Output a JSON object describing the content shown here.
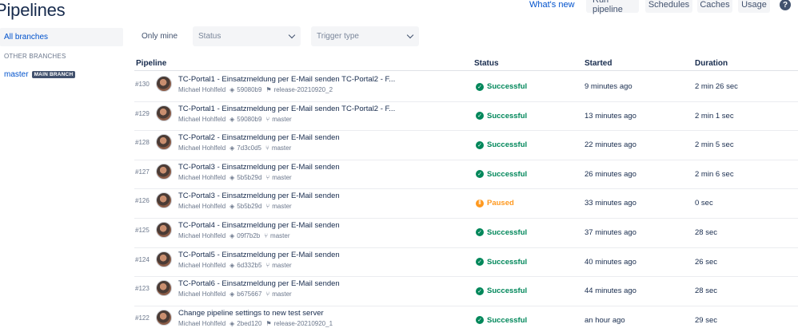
{
  "page": {
    "title": "Pipelines"
  },
  "top_actions": {
    "whats_new": "What's new",
    "run_pipeline": "Run pipeline",
    "schedules": "Schedules",
    "caches": "Caches",
    "usage": "Usage",
    "help_glyph": "?"
  },
  "sidebar": {
    "all_branches": "All branches",
    "other_heading": "OTHER BRANCHES",
    "master_label": "master",
    "main_badge": "MAIN BRANCH"
  },
  "filters": {
    "only_mine": "Only mine",
    "status_placeholder": "Status",
    "trigger_placeholder": "Trigger type"
  },
  "table": {
    "headers": {
      "pipeline": "Pipeline",
      "status": "Status",
      "started": "Started",
      "duration": "Duration"
    },
    "rows": [
      {
        "num": "#130",
        "name": "TC-Portal1 - Einsatzmeldung per E-Mail senden TC-Portal2 - F...",
        "author": "Michael Hohlfeld",
        "commit": "59080b9",
        "ref_icon": "tag-icon",
        "ref": "release-20210920_2",
        "status": "Successful",
        "status_kind": "ok",
        "started": "9 minutes ago",
        "duration": "2 min 26 sec"
      },
      {
        "num": "#129",
        "name": "TC-Portal1 - Einsatzmeldung per E-Mail senden TC-Portal2 - F...",
        "author": "Michael Hohlfeld",
        "commit": "59080b9",
        "ref_icon": "branch-icon",
        "ref": "master",
        "status": "Successful",
        "status_kind": "ok",
        "started": "13 minutes ago",
        "duration": "2 min 1 sec"
      },
      {
        "num": "#128",
        "name": "TC-Portal2 - Einsatzmeldung per E-Mail senden",
        "author": "Michael Hohlfeld",
        "commit": "7d3c0d5",
        "ref_icon": "branch-icon",
        "ref": "master",
        "status": "Successful",
        "status_kind": "ok",
        "started": "22 minutes ago",
        "duration": "2 min 5 sec"
      },
      {
        "num": "#127",
        "name": "TC-Portal3 - Einsatzmeldung per E-Mail senden",
        "author": "Michael Hohlfeld",
        "commit": "5b5b29d",
        "ref_icon": "branch-icon",
        "ref": "master",
        "status": "Successful",
        "status_kind": "ok",
        "started": "26 minutes ago",
        "duration": "2 min 6 sec"
      },
      {
        "num": "#126",
        "name": "TC-Portal3 - Einsatzmeldung per E-Mail senden",
        "author": "Michael Hohlfeld",
        "commit": "5b5b29d",
        "ref_icon": "branch-icon",
        "ref": "master",
        "status": "Paused",
        "status_kind": "paused",
        "started": "33 minutes ago",
        "duration": "0 sec"
      },
      {
        "num": "#125",
        "name": "TC-Portal4 - Einsatzmeldung per E-Mail senden",
        "author": "Michael Hohlfeld",
        "commit": "09f7b2b",
        "ref_icon": "branch-icon",
        "ref": "master",
        "status": "Successful",
        "status_kind": "ok",
        "started": "37 minutes ago",
        "duration": "28 sec"
      },
      {
        "num": "#124",
        "name": "TC-Portal5 - Einsatzmeldung per E-Mail senden",
        "author": "Michael Hohlfeld",
        "commit": "6d332b5",
        "ref_icon": "branch-icon",
        "ref": "master",
        "status": "Successful",
        "status_kind": "ok",
        "started": "40 minutes ago",
        "duration": "26 sec"
      },
      {
        "num": "#123",
        "name": "TC-Portal6 - Einsatzmeldung per E-Mail senden",
        "author": "Michael Hohlfeld",
        "commit": "b675667",
        "ref_icon": "branch-icon",
        "ref": "master",
        "status": "Successful",
        "status_kind": "ok",
        "started": "44 minutes ago",
        "duration": "28 sec"
      },
      {
        "num": "#122",
        "name": "Change pipeline settings to new test server",
        "author": "Michael Hohlfeld",
        "commit": "2bed120",
        "ref_icon": "tag-icon",
        "ref": "release-20210920_1",
        "status": "Successful",
        "status_kind": "ok",
        "started": "an hour ago",
        "duration": "29 sec"
      }
    ]
  },
  "colors": {
    "link": "#0052cc",
    "success": "#00875a",
    "paused": "#ff991f",
    "text": "#172b4d",
    "muted": "#6b778c",
    "button_bg": "#f4f5f7"
  }
}
